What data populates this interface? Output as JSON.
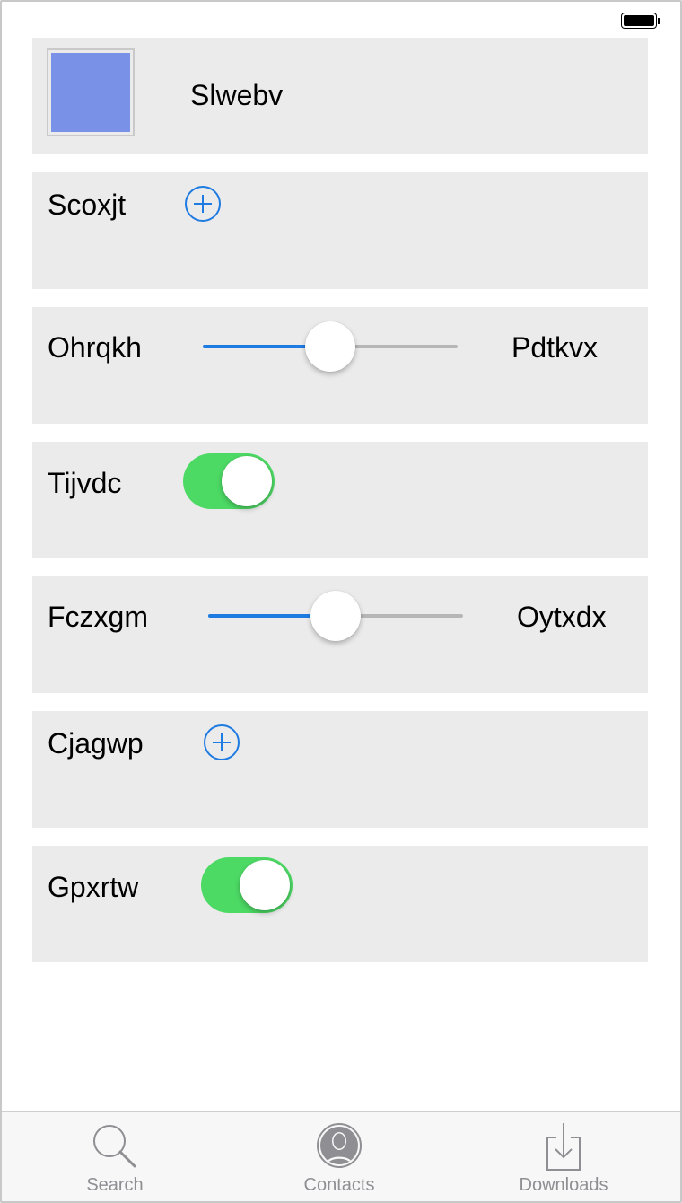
{
  "status_bar": {
    "battery_icon": "battery-full-icon"
  },
  "rows": [
    {
      "kind": "image",
      "label": "Slwebv",
      "swatch_color": "#7a91e8"
    },
    {
      "kind": "add",
      "label": "Scoxjt",
      "icon": "plus-circle-icon"
    },
    {
      "kind": "slider",
      "label": "Ohrqkh",
      "value_label": "Pdtkvx",
      "value_fraction": 0.5
    },
    {
      "kind": "toggle",
      "label": "Tijvdc",
      "on": true
    },
    {
      "kind": "slider",
      "label": "Fczxgm",
      "value_label": "Oytxdx",
      "value_fraction": 0.5
    },
    {
      "kind": "add",
      "label": "Cjagwp",
      "icon": "plus-circle-icon"
    },
    {
      "kind": "toggle",
      "label": "Gpxrtw",
      "on": true
    }
  ],
  "colors": {
    "accent": "#1e7be2",
    "toggle_on": "#4cd964",
    "row_background": "#ebebeb",
    "tab_inactive": "#8e8e93"
  },
  "tabbar": {
    "tabs": [
      {
        "label": "Search",
        "icon": "search-icon"
      },
      {
        "label": "Contacts",
        "icon": "contact-icon"
      },
      {
        "label": "Downloads",
        "icon": "download-icon"
      }
    ]
  }
}
